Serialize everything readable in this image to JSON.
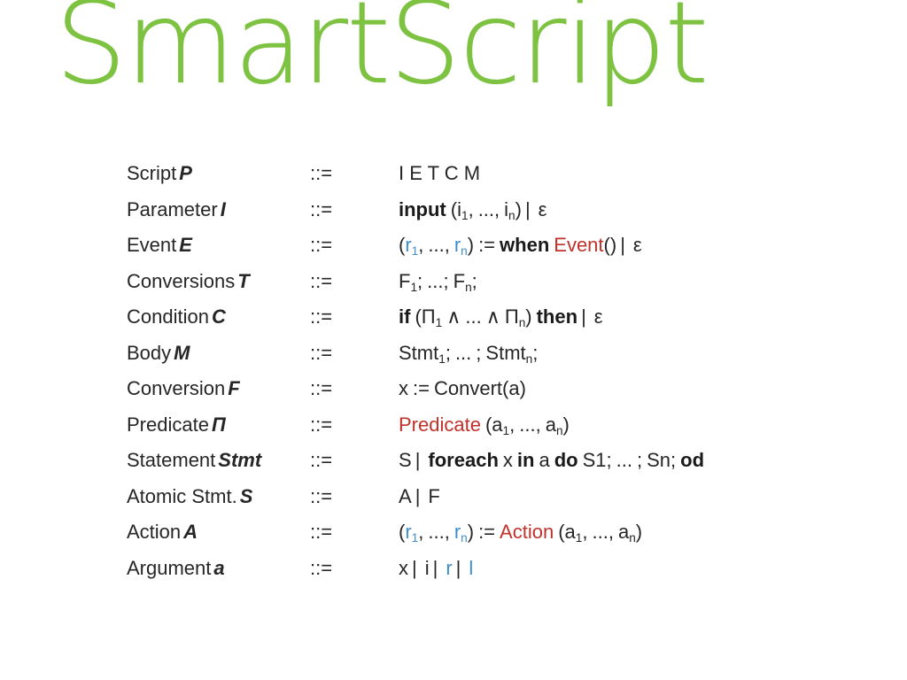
{
  "title": "SmartScript",
  "colors": {
    "title_green": "#7ec242",
    "keyword_black": "#1a1a1a",
    "highlight_red": "#c0322b",
    "variable_blue": "#3f8ecc",
    "background": "#ffffff"
  },
  "grammar": {
    "production_operator": "::=",
    "rules": [
      {
        "name": "Script",
        "symbol": "P",
        "operator": "::=",
        "definition": "I  E  T  C  M"
      },
      {
        "name": "Parameter",
        "symbol": "I",
        "operator": "::=",
        "definition": "input (i1, ..., in)  |  ε"
      },
      {
        "name": "Event",
        "symbol": "E",
        "operator": "::=",
        "definition": "(r1, ..., rn) := when Event()  |  ε"
      },
      {
        "name": "Conversions",
        "symbol": "T",
        "operator": "::=",
        "definition": "F1; ...; Fn;"
      },
      {
        "name": "Condition",
        "symbol": "C",
        "operator": "::=",
        "definition": "if (Π1 ∧ ... ∧ Πn) then  |  ε"
      },
      {
        "name": "Body",
        "symbol": "M",
        "operator": "::=",
        "definition": "Stmt1; ... ; Stmtn;"
      },
      {
        "name": "Conversion",
        "symbol": "F",
        "operator": "::=",
        "definition": "x := Convert(a)"
      },
      {
        "name": "Predicate",
        "symbol": "Π",
        "operator": "::=",
        "definition": "Predicate (a1, ..., an)"
      },
      {
        "name": "Statement",
        "symbol": "Stmt",
        "operator": "::=",
        "definition": "S  |  foreach x in a do S1; ... ; Sn; od"
      },
      {
        "name": "Atomic Stmt.",
        "symbol": "S",
        "operator": "::=",
        "definition": "A  |  F"
      },
      {
        "name": "Action",
        "symbol": "A",
        "operator": "::=",
        "definition": "(r1, ..., rn) := Action (a1, ..., an)"
      },
      {
        "name": "Argument",
        "symbol": "a",
        "operator": "::=",
        "definition": "x  |  i  |  r  |  l"
      }
    ],
    "tokens": {
      "script_rhs": "I  E  T  C  M",
      "kw_input": "input",
      "kw_when": "when",
      "kw_if": "if",
      "kw_then": "then",
      "kw_foreach": "foreach",
      "kw_in": "in",
      "kw_do": "do",
      "kw_od": "od",
      "nt_event": "Event",
      "nt_predicate": "Predicate",
      "nt_action": "Action",
      "epsilon": "ε",
      "assign": ":=",
      "pipe": "|",
      "ellipsis": "...",
      "and": "∧",
      "var_i": "i",
      "var_r": "r",
      "var_l": "l",
      "var_x": "x",
      "var_a": "a",
      "var_F": "F",
      "var_A": "A",
      "var_S": "S",
      "var_Pi": "Π",
      "var_Stmt": "Stmt",
      "var_S1": "S1",
      "var_Sn": "Sn",
      "sub_1": "1",
      "sub_n": "n",
      "paren_open": "(",
      "paren_close": ")",
      "comma": ",",
      "semicolon": ";",
      "convert_call": "Convert(a)",
      "empty_call": "()"
    }
  }
}
